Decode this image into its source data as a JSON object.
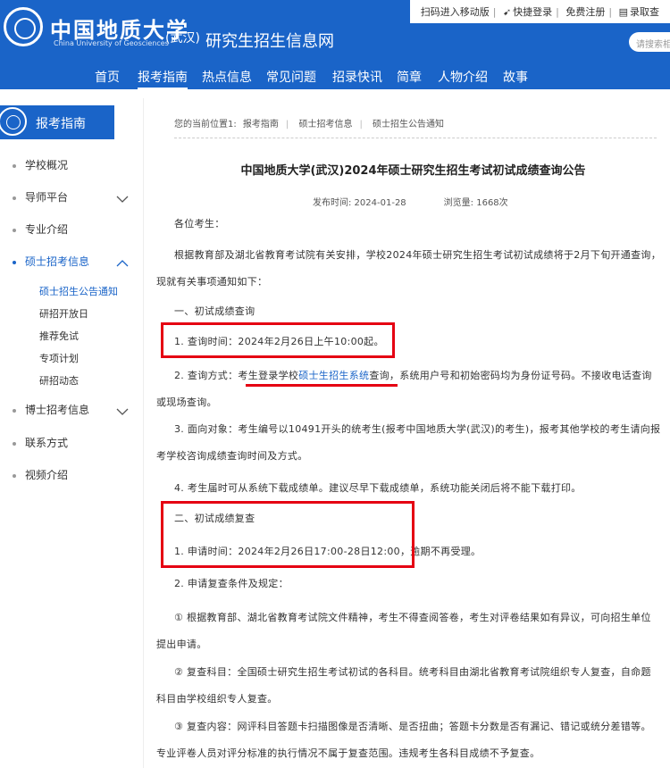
{
  "topbar": {
    "scan_mobile": "扫码进入移动版",
    "quick_login": "快捷登录",
    "free_register": "免费注册",
    "admissions_query": "录取查"
  },
  "header": {
    "school_name": "中国地质大学",
    "school_name_en": "China University of Geosciences",
    "school_sub": "(武汉)",
    "site_title": "研究生招生信息网",
    "search_placeholder": "请搜索相"
  },
  "nav": {
    "items": [
      "首页",
      "报考指南",
      "热点信息",
      "常见问题",
      "招录快讯",
      "简章",
      "人物介绍",
      "故事"
    ],
    "active": "报考指南"
  },
  "sidebar": {
    "heading": "报考指南",
    "items": [
      "学校概况",
      "导师平台",
      "专业介绍",
      "硕士招考信息",
      "博士招考信息",
      "联系方式",
      "视频介绍"
    ],
    "subitems": [
      "硕士招生公告通知",
      "研招开放日",
      "推荐免试",
      "专项计划",
      "研招动态"
    ]
  },
  "breadcrumb": {
    "prefix": "您的当前位置1:",
    "items": [
      "报考指南",
      "硕士招考信息",
      "硕士招生公告通知"
    ]
  },
  "article": {
    "title": "中国地质大学(武汉)2024年硕士研究生招生考试初试成绩查询公告",
    "publish_time": "发布时间:  2024-01-28",
    "views": "浏览量: 1668次",
    "greeting": "各位考生：",
    "intro": "根据教育部及湖北省教育考试院有关安排，学校2024年硕士研究生招生考试初试成绩将于2月下旬开通查询，现就有关事项通知如下：",
    "section1_title": "一、初试成绩查询",
    "s1_item1": "1. 查询时间：2024年2月26日上午10:00起。",
    "s1_item2_pre": "2. 查询方式：考生登录学校",
    "s1_item2_link": "硕士生招生系统",
    "s1_item2_post": "查询，系统用户号和初始密码均为身份证号码。不接收电话查询或现场查询。",
    "s1_item3": "3. 面向对象：考生编号以10491开头的统考生(报考中国地质大学(武汉)的考生)，报考其他学校的考生请向报考学校咨询成绩查询时间及方式。",
    "s1_item4": "4. 考生届时可从系统下载成绩单。建议尽早下载成绩单，系统功能关闭后将不能下载打印。",
    "section2_title": "二、初试成绩复查",
    "s2_item1": "1. 申请时间：2024年2月26日17:00-28日12:00，逾期不再受理。",
    "s2_item2": "2. 申请复查条件及规定：",
    "s2_rule1": "① 根据教育部、湖北省教育考试院文件精神，考生不得查阅答卷，考生对评卷结果如有异议，可向招生单位提出申请。",
    "s2_rule2": "② 复查科目：全国硕士研究生招生考试初试的各科目。统考科目由湖北省教育考试院组织专人复查，自命题科目由学校组织专人复查。",
    "s2_rule3": "③ 复查内容：网评科目答题卡扫描图像是否清晰、是否扭曲；答题卡分数是否有漏记、错记或统分差错等。专业评卷人员对评分标准的执行情况不属于复查范围。违规考生各科目成绩不予复查。"
  },
  "colors": {
    "brand_blue": "#1a64c8",
    "highlight_red": "#e50012"
  }
}
